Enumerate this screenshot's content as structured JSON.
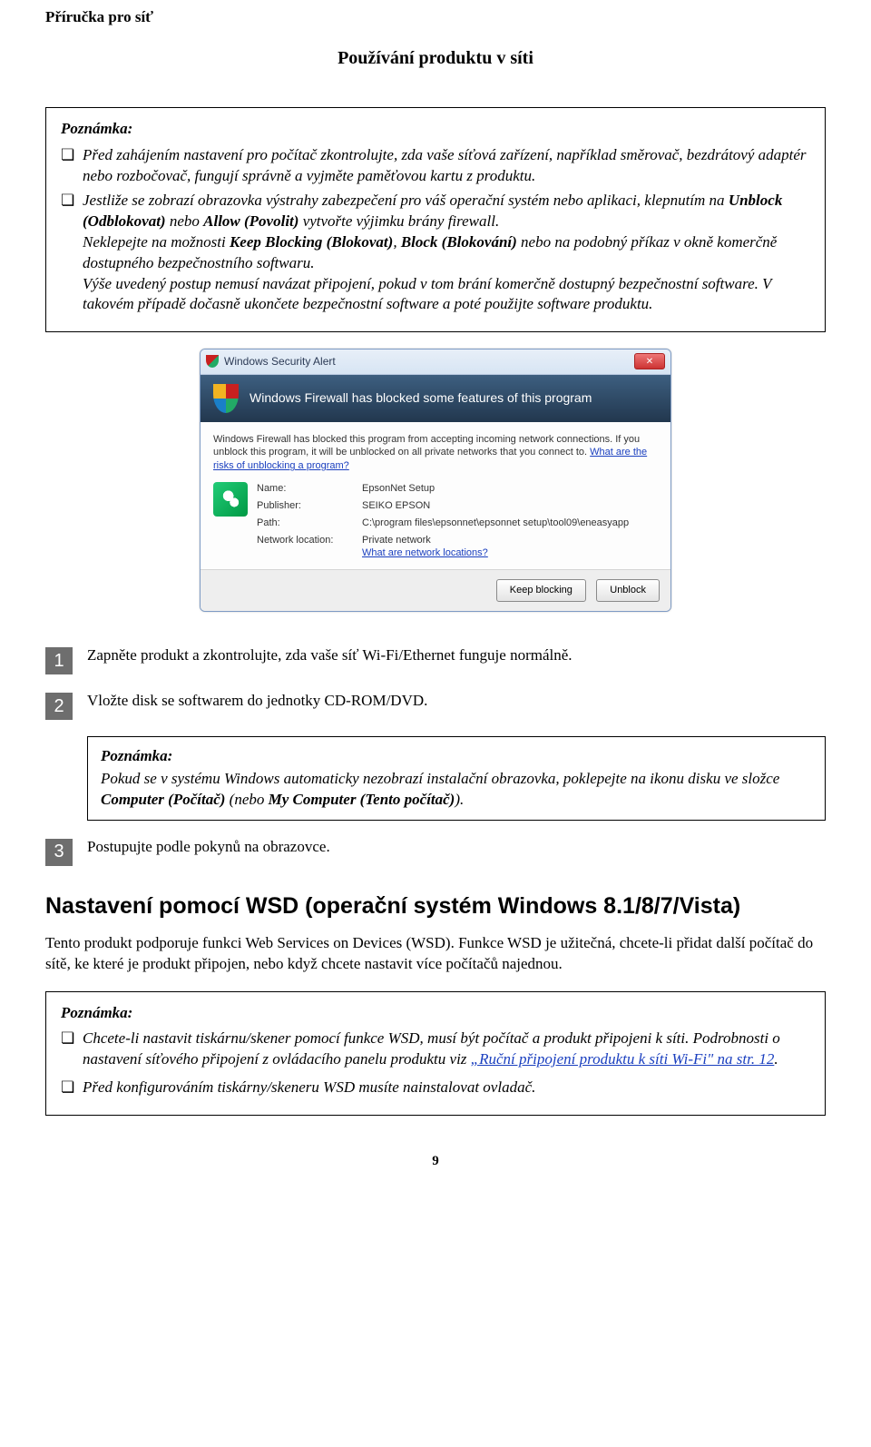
{
  "header": {
    "doc_title": "Příručka pro síť",
    "section_title": "Používání produktu v síti"
  },
  "note1": {
    "title": "Poznámka:",
    "item1": "Před zahájením nastavení pro počítač zkontrolujte, zda vaše síťová zařízení, například směrovač, bezdrátový adaptér nebo rozbočovač, fungují správně a vyjměte paměťovou kartu z produktu.",
    "item2_p1": "Jestliže se zobrazí obrazovka výstrahy zabezpečení pro váš operační systém nebo aplikaci, klepnutím na ",
    "item2_b1": "Unblock (Odblokovat)",
    "item2_p2": " nebo ",
    "item2_b2": "Allow (Povolit)",
    "item2_p3": " vytvořte výjimku brány firewall.",
    "item2_p4": "Neklepejte na možnosti ",
    "item2_b3": "Keep Blocking (Blokovat)",
    "item2_p5": ", ",
    "item2_b4": "Block (Blokování)",
    "item2_p6": " nebo na podobný příkaz v okně komerčně dostupného bezpečnostního softwaru.",
    "item2_p7": "Výše uvedený postup nemusí navázat připojení, pokud v tom brání komerčně dostupný bezpečnostní software. V takovém případě dočasně ukončete bezpečnostní software a poté použijte software produktu."
  },
  "dialog": {
    "title": "Windows Security Alert",
    "close": "✕",
    "banner": "Windows Firewall has blocked some features of this program",
    "desc1": "Windows Firewall has blocked this program from accepting incoming network connections. If you unblock this program, it will be unblocked on all private networks that you connect to. ",
    "desc_link": "What are the risks of unblocking a program?",
    "k_name": "Name:",
    "v_name": "EpsonNet Setup",
    "k_pub": "Publisher:",
    "v_pub": "SEIKO EPSON",
    "k_path": "Path:",
    "v_path": "C:\\program files\\epsonnet\\epsonnet setup\\tool09\\eneasyapp",
    "k_net": "Network location:",
    "v_net": "Private network",
    "v_net_link": "What are network locations?",
    "btn_keep": "Keep blocking",
    "btn_unblock": "Unblock"
  },
  "steps": {
    "s1": "Zapněte produkt a zkontrolujte, zda vaše síť Wi-Fi/Ethernet funguje normálně.",
    "s2": "Vložte disk se softwarem do jednotky CD-ROM/DVD.",
    "s3": "Postupujte podle pokynů na obrazovce."
  },
  "step2_note": {
    "title": "Poznámka:",
    "p1": "Pokud se v systému Windows automaticky nezobrazí instalační obrazovka, poklepejte na ikonu disku ve složce ",
    "b1": "Computer (Počítač)",
    "p2": " (nebo ",
    "b2": "My Computer (Tento počítač)",
    "p3": ")."
  },
  "wsd": {
    "heading": "Nastavení pomocí WSD (operační systém Windows 8.1/8/7/Vista)",
    "para": "Tento produkt podporuje funkci Web Services on Devices (WSD). Funkce WSD je užitečná, chcete-li přidat další počítač do sítě, ke které je produkt připojen, nebo když chcete nastavit více počítačů najednou."
  },
  "note2": {
    "title": "Poznámka:",
    "item1_p1": "Chcete-li nastavit tiskárnu/skener pomocí funkce WSD, musí být počítač a produkt připojeni k síti. Podrobnosti o nastavení síťového připojení z ovládacího panelu produktu viz ",
    "item1_link": "„Ruční připojení produktu k síti Wi-Fi\" na str. 12",
    "item1_p2": ".",
    "item2": "Před konfigurováním tiskárny/skeneru WSD musíte nainstalovat ovladač."
  },
  "page_number": "9"
}
